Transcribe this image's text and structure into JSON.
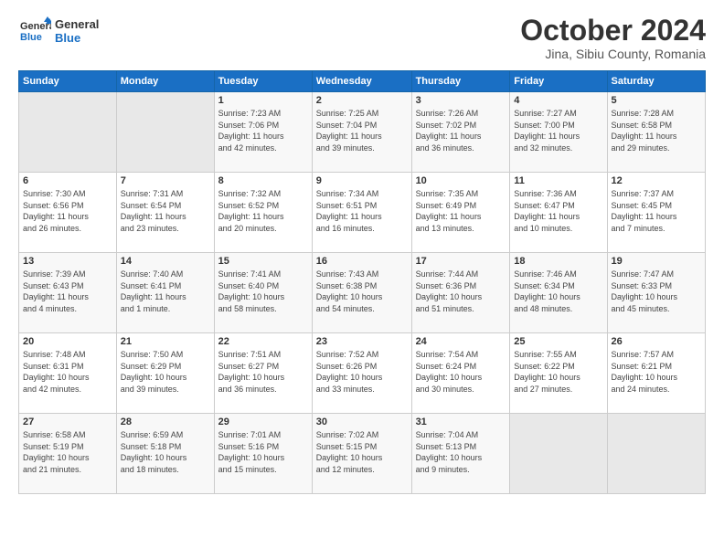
{
  "header": {
    "logo_line1": "General",
    "logo_line2": "Blue",
    "month": "October 2024",
    "location": "Jina, Sibiu County, Romania"
  },
  "weekdays": [
    "Sunday",
    "Monday",
    "Tuesday",
    "Wednesday",
    "Thursday",
    "Friday",
    "Saturday"
  ],
  "weeks": [
    [
      {
        "day": "",
        "detail": ""
      },
      {
        "day": "",
        "detail": ""
      },
      {
        "day": "1",
        "detail": "Sunrise: 7:23 AM\nSunset: 7:06 PM\nDaylight: 11 hours\nand 42 minutes."
      },
      {
        "day": "2",
        "detail": "Sunrise: 7:25 AM\nSunset: 7:04 PM\nDaylight: 11 hours\nand 39 minutes."
      },
      {
        "day": "3",
        "detail": "Sunrise: 7:26 AM\nSunset: 7:02 PM\nDaylight: 11 hours\nand 36 minutes."
      },
      {
        "day": "4",
        "detail": "Sunrise: 7:27 AM\nSunset: 7:00 PM\nDaylight: 11 hours\nand 32 minutes."
      },
      {
        "day": "5",
        "detail": "Sunrise: 7:28 AM\nSunset: 6:58 PM\nDaylight: 11 hours\nand 29 minutes."
      }
    ],
    [
      {
        "day": "6",
        "detail": "Sunrise: 7:30 AM\nSunset: 6:56 PM\nDaylight: 11 hours\nand 26 minutes."
      },
      {
        "day": "7",
        "detail": "Sunrise: 7:31 AM\nSunset: 6:54 PM\nDaylight: 11 hours\nand 23 minutes."
      },
      {
        "day": "8",
        "detail": "Sunrise: 7:32 AM\nSunset: 6:52 PM\nDaylight: 11 hours\nand 20 minutes."
      },
      {
        "day": "9",
        "detail": "Sunrise: 7:34 AM\nSunset: 6:51 PM\nDaylight: 11 hours\nand 16 minutes."
      },
      {
        "day": "10",
        "detail": "Sunrise: 7:35 AM\nSunset: 6:49 PM\nDaylight: 11 hours\nand 13 minutes."
      },
      {
        "day": "11",
        "detail": "Sunrise: 7:36 AM\nSunset: 6:47 PM\nDaylight: 11 hours\nand 10 minutes."
      },
      {
        "day": "12",
        "detail": "Sunrise: 7:37 AM\nSunset: 6:45 PM\nDaylight: 11 hours\nand 7 minutes."
      }
    ],
    [
      {
        "day": "13",
        "detail": "Sunrise: 7:39 AM\nSunset: 6:43 PM\nDaylight: 11 hours\nand 4 minutes."
      },
      {
        "day": "14",
        "detail": "Sunrise: 7:40 AM\nSunset: 6:41 PM\nDaylight: 11 hours\nand 1 minute."
      },
      {
        "day": "15",
        "detail": "Sunrise: 7:41 AM\nSunset: 6:40 PM\nDaylight: 10 hours\nand 58 minutes."
      },
      {
        "day": "16",
        "detail": "Sunrise: 7:43 AM\nSunset: 6:38 PM\nDaylight: 10 hours\nand 54 minutes."
      },
      {
        "day": "17",
        "detail": "Sunrise: 7:44 AM\nSunset: 6:36 PM\nDaylight: 10 hours\nand 51 minutes."
      },
      {
        "day": "18",
        "detail": "Sunrise: 7:46 AM\nSunset: 6:34 PM\nDaylight: 10 hours\nand 48 minutes."
      },
      {
        "day": "19",
        "detail": "Sunrise: 7:47 AM\nSunset: 6:33 PM\nDaylight: 10 hours\nand 45 minutes."
      }
    ],
    [
      {
        "day": "20",
        "detail": "Sunrise: 7:48 AM\nSunset: 6:31 PM\nDaylight: 10 hours\nand 42 minutes."
      },
      {
        "day": "21",
        "detail": "Sunrise: 7:50 AM\nSunset: 6:29 PM\nDaylight: 10 hours\nand 39 minutes."
      },
      {
        "day": "22",
        "detail": "Sunrise: 7:51 AM\nSunset: 6:27 PM\nDaylight: 10 hours\nand 36 minutes."
      },
      {
        "day": "23",
        "detail": "Sunrise: 7:52 AM\nSunset: 6:26 PM\nDaylight: 10 hours\nand 33 minutes."
      },
      {
        "day": "24",
        "detail": "Sunrise: 7:54 AM\nSunset: 6:24 PM\nDaylight: 10 hours\nand 30 minutes."
      },
      {
        "day": "25",
        "detail": "Sunrise: 7:55 AM\nSunset: 6:22 PM\nDaylight: 10 hours\nand 27 minutes."
      },
      {
        "day": "26",
        "detail": "Sunrise: 7:57 AM\nSunset: 6:21 PM\nDaylight: 10 hours\nand 24 minutes."
      }
    ],
    [
      {
        "day": "27",
        "detail": "Sunrise: 6:58 AM\nSunset: 5:19 PM\nDaylight: 10 hours\nand 21 minutes."
      },
      {
        "day": "28",
        "detail": "Sunrise: 6:59 AM\nSunset: 5:18 PM\nDaylight: 10 hours\nand 18 minutes."
      },
      {
        "day": "29",
        "detail": "Sunrise: 7:01 AM\nSunset: 5:16 PM\nDaylight: 10 hours\nand 15 minutes."
      },
      {
        "day": "30",
        "detail": "Sunrise: 7:02 AM\nSunset: 5:15 PM\nDaylight: 10 hours\nand 12 minutes."
      },
      {
        "day": "31",
        "detail": "Sunrise: 7:04 AM\nSunset: 5:13 PM\nDaylight: 10 hours\nand 9 minutes."
      },
      {
        "day": "",
        "detail": ""
      },
      {
        "day": "",
        "detail": ""
      }
    ]
  ]
}
